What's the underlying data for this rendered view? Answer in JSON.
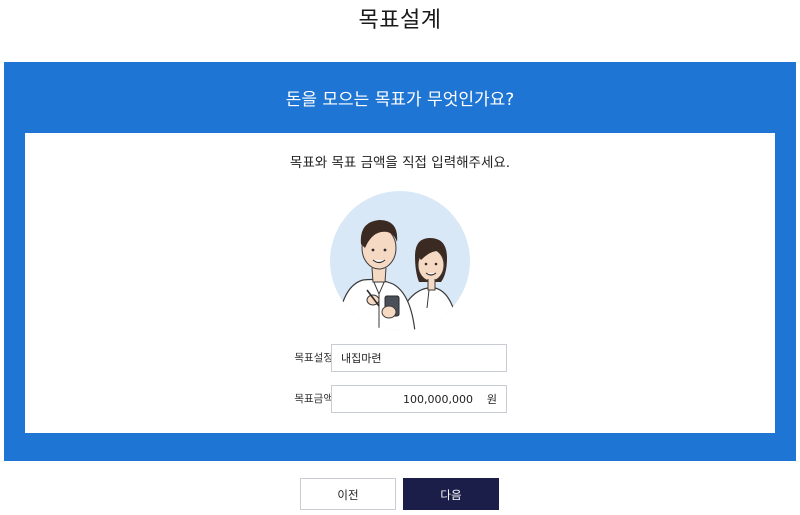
{
  "page": {
    "title": "목표설계"
  },
  "panel": {
    "heading": "돈을 모으는 목표가 무엇인가요?",
    "instruction": "목표와 목표 금액을 직접 입력해주세요.",
    "illustration_icon": "couple-planning-illustration"
  },
  "form": {
    "goal": {
      "label": "목표설정",
      "value": "내집마련"
    },
    "amount": {
      "label": "목표금액",
      "value": "100,000,000",
      "unit": "원"
    }
  },
  "buttons": {
    "prev_label": "이전",
    "next_label": "다음"
  },
  "colors": {
    "panel_blue": "#1f75d3",
    "next_button": "#1c1e4a",
    "illustration_bg": "#d8e8f7"
  }
}
